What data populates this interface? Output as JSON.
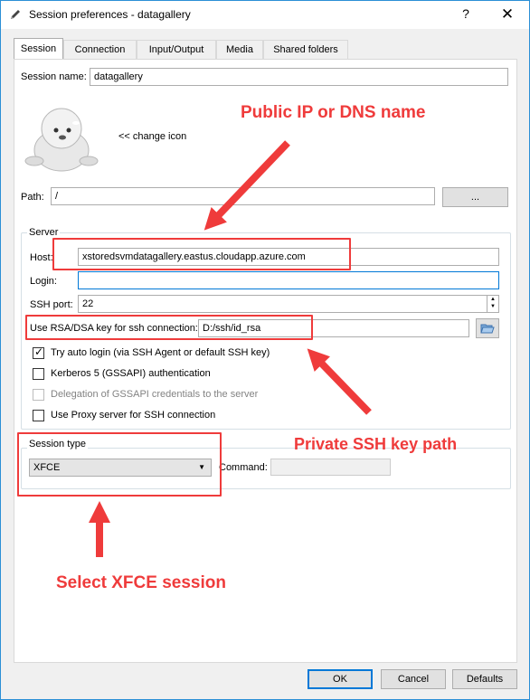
{
  "window": {
    "title": "Session preferences - datagallery",
    "help_label": "?",
    "close_label": "✕"
  },
  "tabs": [
    {
      "label": "Session"
    },
    {
      "label": "Connection"
    },
    {
      "label": "Input/Output"
    },
    {
      "label": "Media"
    },
    {
      "label": "Shared folders"
    }
  ],
  "session": {
    "name_label": "Session name:",
    "name_value": "datagallery",
    "change_icon_label": "<< change icon",
    "path_label": "Path:",
    "path_value": "/",
    "browse_label": "..."
  },
  "server": {
    "group_label": "Server",
    "host_label": "Host:",
    "host_value": "xstoredsvmdatagallery.eastus.cloudapp.azure.com",
    "login_label": "Login:",
    "login_value": "",
    "port_label": "SSH port:",
    "port_value": "22",
    "key_label": "Use RSA/DSA key for ssh connection:",
    "key_value": "D:/ssh/id_rsa",
    "options": [
      {
        "label": "Try auto login (via SSH Agent or default SSH key)",
        "checked": true,
        "enabled": true
      },
      {
        "label": "Kerberos 5 (GSSAPI) authentication",
        "checked": false,
        "enabled": true
      },
      {
        "label": "Delegation of GSSAPI credentials to the server",
        "checked": false,
        "enabled": false
      },
      {
        "label": "Use Proxy server for SSH connection",
        "checked": false,
        "enabled": true
      }
    ]
  },
  "session_type": {
    "group_label": "Session type",
    "selected": "XFCE",
    "command_label": "Command:",
    "command_value": ""
  },
  "footer": {
    "ok_label": "OK",
    "cancel_label": "Cancel",
    "defaults_label": "Defaults"
  },
  "annotations": {
    "host_note": "Public IP or DNS name",
    "key_note": "Private SSH key path",
    "session_note": "Select XFCE session",
    "color": "#ef3b3b"
  },
  "icons": {
    "title": "pencil-icon",
    "session": "seal-mascot-icon",
    "folder": "folder-open-icon"
  }
}
